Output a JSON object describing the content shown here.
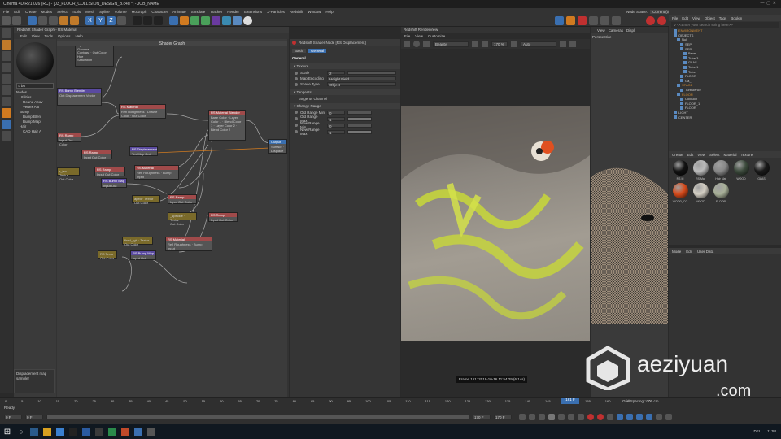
{
  "window": {
    "title": "Cinema 4D R21.026 (RC) - [03_FLOOR_COLLISION_DESIGN_B.c4d *] - JOB_NAME"
  },
  "menu": [
    "File",
    "Edit",
    "Create",
    "Modes",
    "Select",
    "Tools",
    "Mesh",
    "Spline",
    "Volume",
    "MoGraph",
    "Character",
    "Animate",
    "Simulate",
    "Tracker",
    "Render",
    "Extensions",
    "X-Particles",
    "Redshift",
    "Window",
    "Help"
  ],
  "node_space": {
    "label": "Node Space:",
    "value": "Current (Standard/Physical)"
  },
  "layout": {
    "label": "Layout:",
    "value": "FH_SQUARE (User)"
  },
  "shader_graph": {
    "window_title": "Redshift Shader Graph - RS Material",
    "menu": [
      "Edit",
      "View",
      "Tools",
      "Options",
      "Help"
    ],
    "canvas_title": "Shader Graph",
    "search_value": "bu",
    "tree_items": [
      "Nodes",
      "Utilities",
      "Round Abov",
      "Vertex Attr",
      "Bump",
      "Bump Blen",
      "Bump Map",
      "Hair",
      "CAD Hair A"
    ],
    "nodes": [
      {
        "title": "RS Bump Blender",
        "body": "Out Displacement Vector"
      },
      {
        "title": "RS Material",
        "body": "Refl Roughness · Diffuse Color · Out Color"
      },
      {
        "title": "RS Material Blender",
        "body": "Base Color · Layer Color 1 · Blend Color 1 · Layer Color 2 · Blend Color 2"
      },
      {
        "title": "RS Ramp",
        "body": "Input Out Color"
      },
      {
        "title": "RS Ramp",
        "body": "Input Out Color"
      },
      {
        "title": "RS Displacement",
        "body": "Tex Map Out"
      },
      {
        "title": "RS Ramp",
        "body": "Input Out Color"
      },
      {
        "title": "RS Material",
        "body": "Refl Roughness · Bump Input"
      },
      {
        "title": "RS Bump Map",
        "body": "Input Out"
      },
      {
        "title": "RS Ramp",
        "body": "Input Out Color"
      },
      {
        "title": "RS Ramp",
        "body": "Input Out Color"
      },
      {
        "title": "RS Material",
        "body": "Refl Roughness · Bump Input"
      },
      {
        "title": "RS Bump Map",
        "body": "Input Out"
      },
      {
        "title": "Output",
        "body": "Surface · Displace"
      }
    ],
    "info_text": "Displacement map sampler"
  },
  "attributes": {
    "header": "Redshift Shader Node [RS Displacement]",
    "tabs": [
      "Basic",
      "General"
    ],
    "section": "General",
    "texture_label": "Texture",
    "scale_label": "Scale",
    "scale_value": "2",
    "map_encoding_label": "Map Encoding",
    "map_encoding_value": "Height Field",
    "space_type_label": "Space Type",
    "space_type_value": "Object",
    "tangents_label": "Tangents",
    "tangents_channel": "Tangents Channel",
    "change_range_label": "Change Range",
    "old_min_label": "Old Range Min",
    "old_min_value": "0",
    "old_max_label": "Old Range Max",
    "old_max_value": "1",
    "new_min_label": "New Range Min",
    "new_min_value": "0",
    "new_max_label": "New Range Max",
    "new_max_value": "1"
  },
  "render_view": {
    "title": "Redshift RenderView",
    "menu": [
      "File",
      "View",
      "Customize"
    ],
    "aov": "Beauty",
    "zoom": "170 %",
    "fit": "Auto",
    "status": "Frame 161: 2019-10-16 11:54:29 (6.14s)",
    "progress": "Progressive Rendering..."
  },
  "viewport": {
    "menu": [
      "View",
      "Cameras",
      "Displ"
    ],
    "label": "Perspective"
  },
  "object_manager": {
    "menu": [
      "File",
      "Edit",
      "View",
      "Object",
      "Tags",
      "Bookm"
    ],
    "search_placeholder": "<<Enter your search string here>>",
    "objects": [
      "ENVIRONMENT",
      "OBJECTS",
      "Null",
      "SEP",
      "SEP",
      "Bevel",
      "Tube.3",
      "GLAS",
      "Tube.1",
      "Tube",
      "FLOOR",
      "Ga_",
      "STAGE",
      "Turbulence",
      "FLOOR",
      "Collision",
      "FLOOR_1",
      "FLOOR",
      "LIGHT",
      "CENTER"
    ]
  },
  "material_manager": {
    "menu": [
      "Create",
      "Edit",
      "View",
      "Select",
      "Material",
      "Texture"
    ],
    "materials": [
      {
        "name": "RS M",
        "color": "#111111"
      },
      {
        "name": "RS Mat",
        "color": "#bbbbbb"
      },
      {
        "name": "Hair Mat",
        "color": "#888888"
      },
      {
        "name": "WOOD",
        "color": "#3c4a3c"
      },
      {
        "name": "GLAS",
        "color": "#1a1a1a"
      },
      {
        "name": "WOOD_CO",
        "color": "#d64a1a"
      },
      {
        "name": "WOOD",
        "color": "#d4cfc4"
      },
      {
        "name": "FLOOR",
        "color": "#a8b098"
      }
    ]
  },
  "attribute_manager": {
    "menu": [
      "Mode",
      "Edit",
      "User Data"
    ]
  },
  "timeline": {
    "ticks": [
      "0",
      "5",
      "10",
      "15",
      "20",
      "25",
      "30",
      "35",
      "40",
      "45",
      "50",
      "55",
      "60",
      "65",
      "70",
      "75",
      "80",
      "85",
      "90",
      "95",
      "100",
      "105",
      "110",
      "115",
      "120",
      "125",
      "130",
      "135",
      "140",
      "145",
      "150",
      "155",
      "160",
      "165",
      "170"
    ],
    "status": "Ready",
    "start": "0 F",
    "current": "0 F",
    "end": "170 F",
    "end2": "170 F",
    "frame": "161 F",
    "grid": "Grid Spacing : 100 cm"
  },
  "taskbar": {
    "lang": "DEU",
    "time": "11:54"
  },
  "watermark": {
    "text1": "aeziyuan",
    "text2": ".com"
  }
}
